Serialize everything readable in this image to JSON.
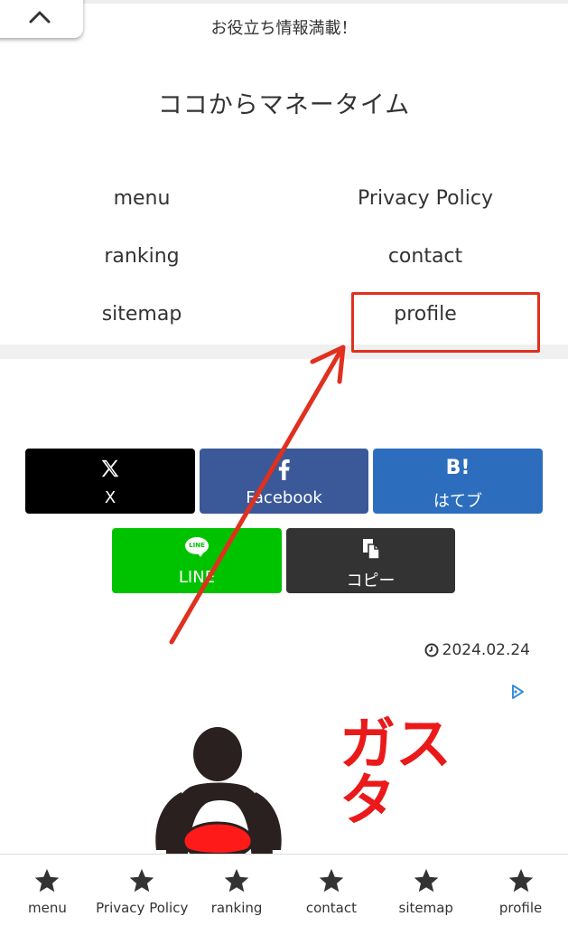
{
  "header": {
    "tagline": "お役立ち情報満載！",
    "site_title": "ココからマネータイム"
  },
  "nav": {
    "items": [
      {
        "label": "menu"
      },
      {
        "label": "Privacy Policy"
      },
      {
        "label": "ranking"
      },
      {
        "label": "contact"
      },
      {
        "label": "sitemap"
      },
      {
        "label": "profile"
      }
    ]
  },
  "share": {
    "x_label": "X",
    "facebook_label": "Facebook",
    "hatena_icon": "B!",
    "hatena_label": "はてブ",
    "line_icon": "LINE",
    "line_label": "LINE",
    "copy_label": "コピー"
  },
  "post": {
    "date": "2024.02.24"
  },
  "ad": {
    "text": "ガスタ"
  },
  "bottom_nav": {
    "items": [
      {
        "label": "menu"
      },
      {
        "label": "Privacy Policy"
      },
      {
        "label": "ranking"
      },
      {
        "label": "contact"
      },
      {
        "label": "sitemap"
      },
      {
        "label": "profile"
      }
    ]
  },
  "colors": {
    "x": "#000000",
    "facebook": "#3b5998",
    "hatena": "#2c6ebd",
    "line": "#00c300",
    "copy": "#333333",
    "highlight": "#e0301e"
  },
  "icons": {
    "back": "chevron-up-icon",
    "x": "x-logo-icon",
    "facebook": "facebook-f-icon",
    "copy": "copy-icon",
    "clock": "clock-icon",
    "ad": "ad-choices-icon",
    "bottom_nav": "star-icon"
  }
}
